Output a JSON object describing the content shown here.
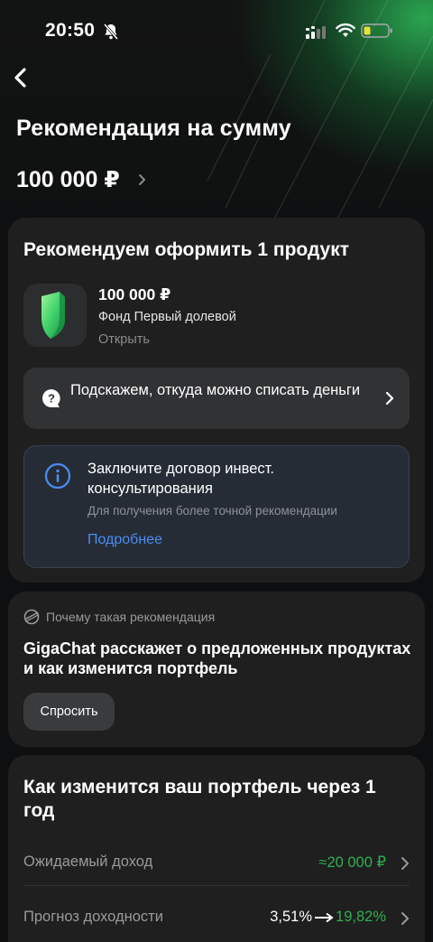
{
  "status_bar": {
    "time": "20:50"
  },
  "header": {
    "title": "Рекомендация на сумму",
    "amount": "100 000 ₽"
  },
  "recommend_card": {
    "title": "Рекомендуем оформить 1 продукт",
    "product": {
      "amount": "100 000 ₽",
      "name": "Фонд Первый долевой",
      "action": "Открыть"
    },
    "hint": "Подскажем, откуда можно списать деньги",
    "info": {
      "title": "Заключите договор инвест. консультирования",
      "subtitle": "Для получения более точной рекомендации",
      "link": "Подробнее"
    }
  },
  "gigachat_card": {
    "heading": "Почему такая рекомендация",
    "text": "GigaChat расскажет о предложенных продуктах и как изменится портфель",
    "button": "Спросить"
  },
  "portfolio_card": {
    "title": "Как изменится ваш портфель через 1 год",
    "rows": [
      {
        "label": "Ожидаемый доход",
        "value": "≈20 000 ₽"
      },
      {
        "label": "Прогноз доходности",
        "from": "3,51%",
        "to": "19,82%"
      }
    ]
  },
  "colors": {
    "background": "#0e0f10",
    "card": "#1f1f20",
    "accent_green": "#2fb14f",
    "link_blue": "#4a8df2",
    "brand_glow": "#2ebe5a"
  }
}
